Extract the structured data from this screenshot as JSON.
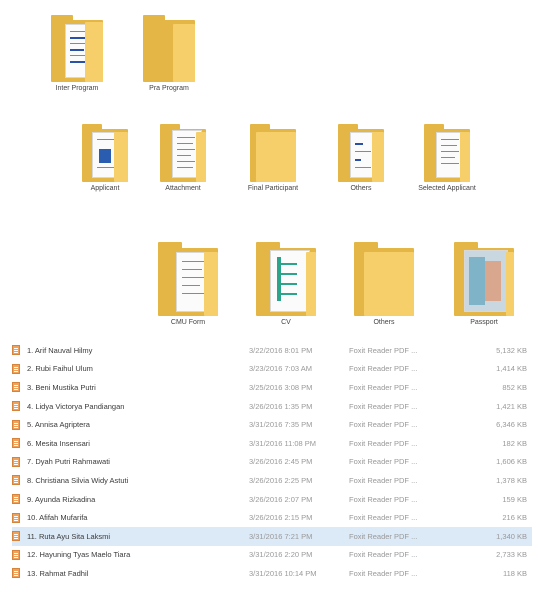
{
  "folders_top": [
    {
      "label": "Inter Program"
    },
    {
      "label": "Pra Program"
    }
  ],
  "folders_middle": [
    {
      "label": "Applicant"
    },
    {
      "label": "Attachment"
    },
    {
      "label": "Final Participant"
    },
    {
      "label": "Others"
    },
    {
      "label": "Selected Applicant"
    }
  ],
  "folders_bottom": [
    {
      "label": "CMU Form"
    },
    {
      "label": "CV"
    },
    {
      "label": "Others"
    },
    {
      "label": "Passport"
    }
  ],
  "files": [
    {
      "name": "1. Arif Nauval Hilmy",
      "date": "3/22/2016 8:01 PM",
      "type": "Foxit Reader PDF ...",
      "size": "5,132 KB"
    },
    {
      "name": "2. Rubi Faihul Ulum",
      "date": "3/23/2016 7:03 AM",
      "type": "Foxit Reader PDF ...",
      "size": "1,414 KB"
    },
    {
      "name": "3. Beni Mustika Putri",
      "date": "3/25/2016 3:08 PM",
      "type": "Foxit Reader PDF ...",
      "size": "852 KB"
    },
    {
      "name": "4. Lidya Victorya Pandiangan",
      "date": "3/26/2016 1:35 PM",
      "type": "Foxit Reader PDF ...",
      "size": "1,421 KB"
    },
    {
      "name": "5. Annisa Agriptera",
      "date": "3/31/2016 7:35 PM",
      "type": "Foxit Reader PDF ...",
      "size": "6,346 KB"
    },
    {
      "name": "6. Mesita Insensari",
      "date": "3/31/2016 11:08 PM",
      "type": "Foxit Reader PDF ...",
      "size": "182 KB"
    },
    {
      "name": "7. Dyah Putri Rahmawati",
      "date": "3/26/2016 2:45 PM",
      "type": "Foxit Reader PDF ...",
      "size": "1,606 KB"
    },
    {
      "name": "8. Christiana Silvia Widy Astuti",
      "date": "3/26/2016 2:25 PM",
      "type": "Foxit Reader PDF ...",
      "size": "1,378 KB"
    },
    {
      "name": "9. Ayunda Rizkadina",
      "date": "3/26/2016 2:07 PM",
      "type": "Foxit Reader PDF ...",
      "size": "159 KB"
    },
    {
      "name": "10. Afifah Mufarifa",
      "date": "3/26/2016 2:15 PM",
      "type": "Foxit Reader PDF ...",
      "size": "216 KB"
    },
    {
      "name": "11. Ruta Ayu Sita Laksmi",
      "date": "3/31/2016 7:21 PM",
      "type": "Foxit Reader PDF ...",
      "size": "1,340 KB",
      "selected": true
    },
    {
      "name": "12. Hayuning Tyas Maelo Tiara",
      "date": "3/31/2016 2:20 PM",
      "type": "Foxit Reader PDF ...",
      "size": "2,733 KB"
    },
    {
      "name": "13. Rahmat Fadhil",
      "date": "3/31/2016 10:14 PM",
      "type": "Foxit Reader PDF ...",
      "size": "118 KB"
    }
  ],
  "colors": {
    "folder_back": "#e3b646",
    "folder_front": "#f6cf6a",
    "selection": "#dce9f7",
    "pdf_icon": "#f0a25a"
  }
}
